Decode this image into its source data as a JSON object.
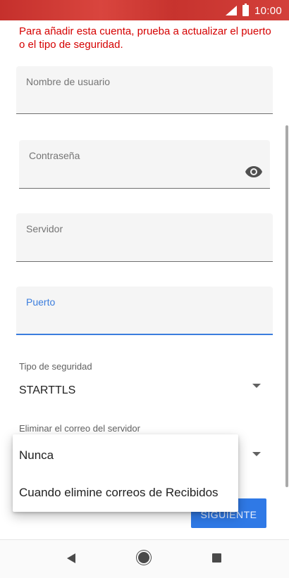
{
  "status_bar": {
    "time": "10:00"
  },
  "error_message": "Para añadir esta cuenta, prueba a actualizar el puerto o el tipo de seguridad.",
  "fields": {
    "username": {
      "label": "Nombre de usuario",
      "value": ""
    },
    "password": {
      "label": "Contraseña",
      "value": ""
    },
    "server": {
      "label": "Servidor",
      "value": ""
    },
    "port": {
      "label": "Puerto",
      "value": ""
    }
  },
  "security": {
    "label": "Tipo de seguridad",
    "value": "STARTTLS"
  },
  "delete_from_server": {
    "label": "Eliminar el correo del servidor"
  },
  "menu": {
    "options": [
      "Nunca",
      "Cuando elimine correos de Recibidos"
    ]
  },
  "next_button": {
    "label": "SIGUIENTE"
  },
  "colors": {
    "accent": "#3b7ddd",
    "error": "#d50000",
    "button": "#2f79e6",
    "status_bar": "#c5302c"
  }
}
